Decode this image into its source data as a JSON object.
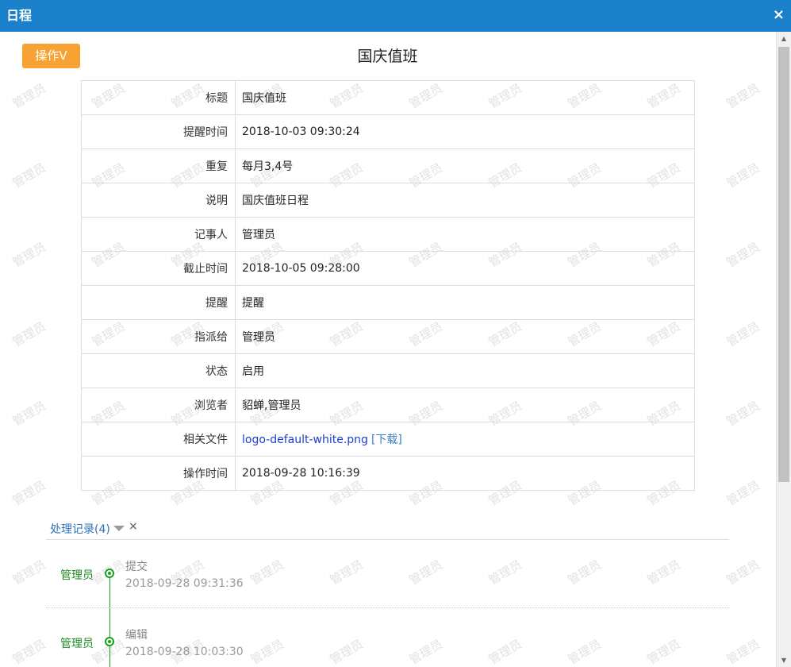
{
  "window": {
    "title": "日程",
    "close_label": "×"
  },
  "toolbar": {
    "op_button_label": "操作V"
  },
  "page": {
    "title": "国庆值班"
  },
  "details": [
    {
      "label": "标题",
      "value": "国庆值班"
    },
    {
      "label": "提醒时间",
      "value": "2018-10-03 09:30:24"
    },
    {
      "label": "重复",
      "value": "每月3,4号"
    },
    {
      "label": "说明",
      "value": "国庆值班日程"
    },
    {
      "label": "记事人",
      "value": "管理员"
    },
    {
      "label": "截止时间",
      "value": "2018-10-05 09:28:00"
    },
    {
      "label": "提醒",
      "value": "提醒"
    },
    {
      "label": "指派给",
      "value": "管理员"
    },
    {
      "label": "状态",
      "value": "启用"
    },
    {
      "label": "浏览者",
      "value": "貂蝉,管理员"
    },
    {
      "label": "相关文件",
      "file_name": "logo-default-white.png",
      "download_label": "[下载]"
    },
    {
      "label": "操作时间",
      "value": "2018-09-28 10:16:39"
    }
  ],
  "records": {
    "title": "处理记录(4)",
    "close_label": "×",
    "items": [
      {
        "user": "管理员",
        "action": "提交",
        "time": "2018-09-28 09:31:36"
      },
      {
        "user": "管理员",
        "action": "编辑",
        "time": "2018-09-28 10:03:30"
      }
    ]
  },
  "watermark": {
    "text": "管理员"
  },
  "colors": {
    "titlebar": "#1a80c9",
    "op_button": "#f7a233",
    "status_enabled": "#2d8a2d",
    "timeline": "#1ba01b",
    "link": "#1a3fcf"
  },
  "icons": {
    "close": "close-icon",
    "caret": "caret-down-icon"
  }
}
